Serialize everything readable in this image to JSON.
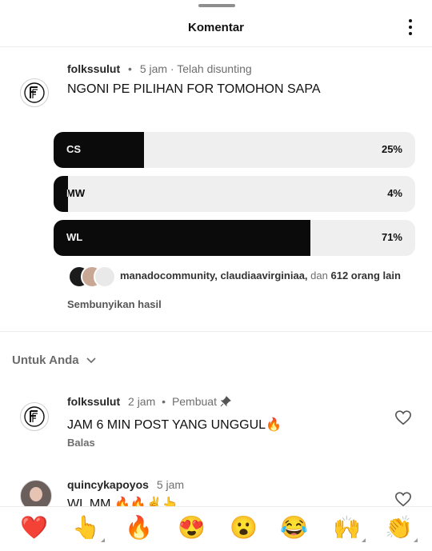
{
  "header": {
    "title": "Komentar"
  },
  "post": {
    "username": "folkssulut",
    "dot": "•",
    "time": "5 jam · Telah disunting",
    "text": "NGONI PE PILIHAN FOR TOMOHON SAPA",
    "poll": [
      {
        "label": "CS",
        "percent_text": "25%",
        "fraction": 0.25
      },
      {
        "label": "MW",
        "percent_text": "4%",
        "fraction": 0.04
      },
      {
        "label": "WL",
        "percent_text": "71%",
        "fraction": 0.71
      }
    ],
    "voters": {
      "names": "manadocommunity, claudiaavirginiaa,",
      "conj": "dan",
      "others": "612 orang lain"
    },
    "hide_results": "Sembunyikan hasil"
  },
  "section": {
    "title": "Untuk Anda"
  },
  "comments": [
    {
      "username": "folkssulut",
      "time": "2 jam",
      "sep": "•",
      "badge": "Pembuat",
      "text": "JAM 6 MIN POST YANG UNGGUL🔥",
      "reply": "Balas"
    },
    {
      "username": "quincykapoyos",
      "time": "5 jam",
      "text": "WL MM 🔥🔥✌️👆"
    }
  ],
  "emoji_bar": [
    "❤️",
    "👆",
    "🔥",
    "😍",
    "😮",
    "😂",
    "🙌",
    "👏"
  ],
  "colors": {
    "poll_fill": "#0b0b0b",
    "poll_track": "#efefef",
    "heart": "#e0202b"
  }
}
